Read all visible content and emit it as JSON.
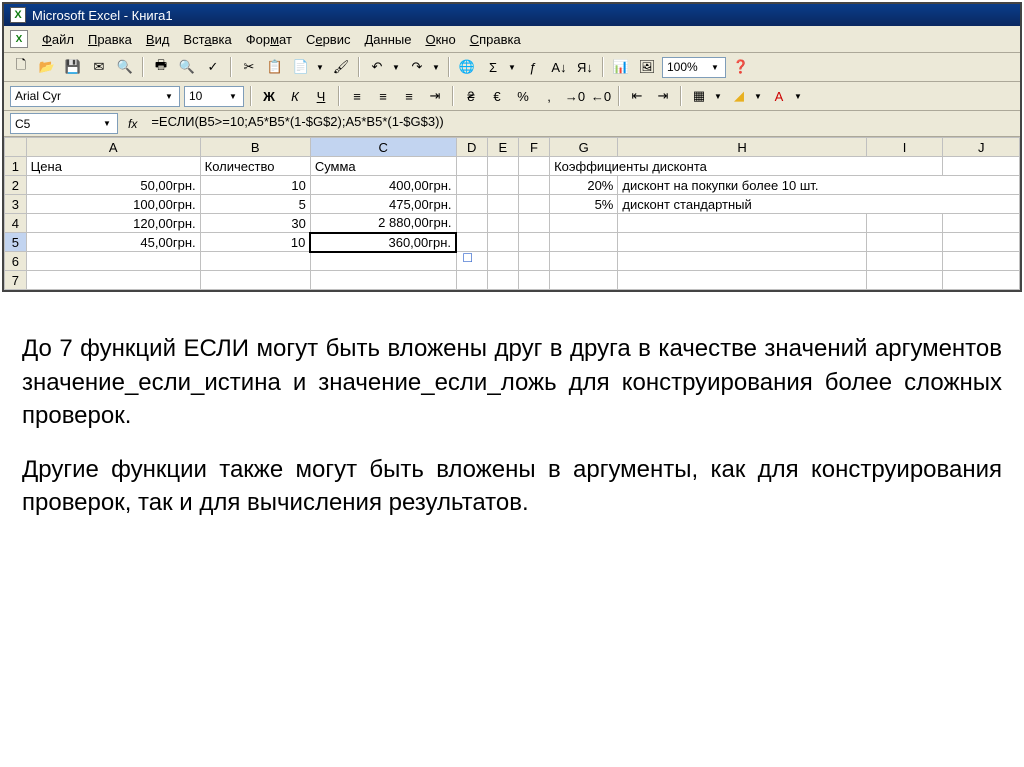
{
  "title": "Microsoft Excel - Книга1",
  "menu": [
    "Файл",
    "Правка",
    "Вид",
    "Вставка",
    "Формат",
    "Сервис",
    "Данные",
    "Окно",
    "Справка"
  ],
  "font": {
    "name": "Arial Cyr",
    "size": "10"
  },
  "zoom": "100%",
  "namebox": "C5",
  "fx": "fx",
  "formula": "=ЕСЛИ(B5>=10;A5*B5*(1-$G$2);A5*B5*(1-$G$3))",
  "columns": [
    "A",
    "B",
    "C",
    "D",
    "E",
    "F",
    "G",
    "H",
    "I",
    "J"
  ],
  "rows": {
    "1": {
      "A": "Цена",
      "B": "Количество",
      "C": "Сумма",
      "G": "Коэффициенты дисконта"
    },
    "2": {
      "A": "50,00грн.",
      "B": "10",
      "C": "400,00грн.",
      "G": "20%",
      "H": "дисконт на покупки более 10 шт."
    },
    "3": {
      "A": "100,00грн.",
      "B": "5",
      "C": "475,00грн.",
      "G": "5%",
      "H": "дисконт стандартный"
    },
    "4": {
      "A": "120,00грн.",
      "B": "30",
      "C": "2 880,00грн."
    },
    "5": {
      "A": "45,00грн.",
      "B": "10",
      "C": "360,00грн."
    }
  },
  "format_btns": {
    "bold": "Ж",
    "italic": "К",
    "underline": "Ч"
  },
  "body": {
    "p1": "До 7 функций ЕСЛИ могут быть вложены друг в друга в качестве значений аргументов значение_если_истина и значение_если_ложь для конструирования более сложных проверок.",
    "p2": "Другие функции также могут быть вложены в аргументы, как для конструирования проверок, так и для вычисления результатов."
  }
}
